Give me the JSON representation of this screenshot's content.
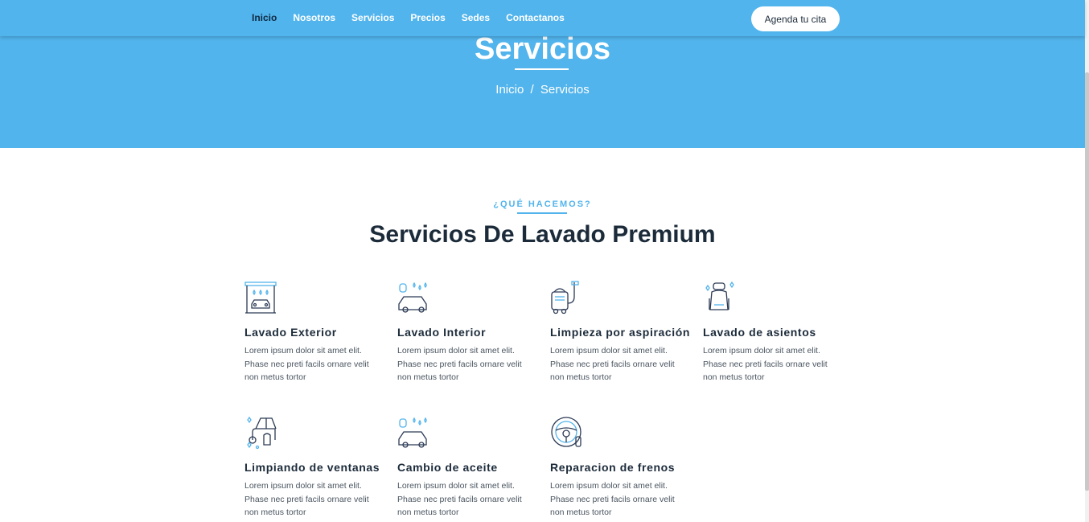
{
  "nav": {
    "links": [
      "Inicio",
      "Nosotros",
      "Servicios",
      "Precios",
      "Sedes",
      "Contactanos"
    ],
    "cta": "Agenda tu cita"
  },
  "hero": {
    "title": "Servicios",
    "breadcrumb": {
      "home": "Inicio",
      "separator": "/",
      "current": "Servicios"
    }
  },
  "section": {
    "kicker": "¿QUÉ HACEMOS?",
    "title": "Servicios De Lavado Premium"
  },
  "services": [
    {
      "title": "Lavado Exterior",
      "desc": "Lorem ipsum dolor sit amet elit. Phase nec preti facils ornare velit non metus tortor",
      "icon": "car-wash-tunnel-icon"
    },
    {
      "title": "Lavado Interior",
      "desc": "Lorem ipsum dolor sit amet elit. Phase nec preti facils ornare velit non metus tortor",
      "icon": "car-soap-icon"
    },
    {
      "title": "Limpieza por aspiración",
      "desc": "Lorem ipsum dolor sit amet elit. Phase nec preti facils ornare velit non metus tortor",
      "icon": "vacuum-cleaner-icon"
    },
    {
      "title": "Lavado de asientos",
      "desc": "Lorem ipsum dolor sit amet elit. Phase nec preti facils ornare velit non metus tortor",
      "icon": "car-seat-icon"
    },
    {
      "title": "Limpiando de ventanas",
      "desc": "Lorem ipsum dolor sit amet elit. Phase nec preti facils ornare velit non metus tortor",
      "icon": "window-cleaning-icon"
    },
    {
      "title": "Cambio de aceite",
      "desc": "Lorem ipsum dolor sit amet elit. Phase nec preti facils ornare velit non metus tortor",
      "icon": "car-soap-icon"
    },
    {
      "title": "Reparacion de frenos",
      "desc": "Lorem ipsum dolor sit amet elit. Phase nec preti facils ornare velit non metus tortor",
      "icon": "steering-wheel-icon"
    }
  ],
  "colors": {
    "accent": "#52b4ec",
    "heading": "#1c2b3a",
    "text": "#4a5560",
    "icon_stroke": "#2b3a55"
  }
}
